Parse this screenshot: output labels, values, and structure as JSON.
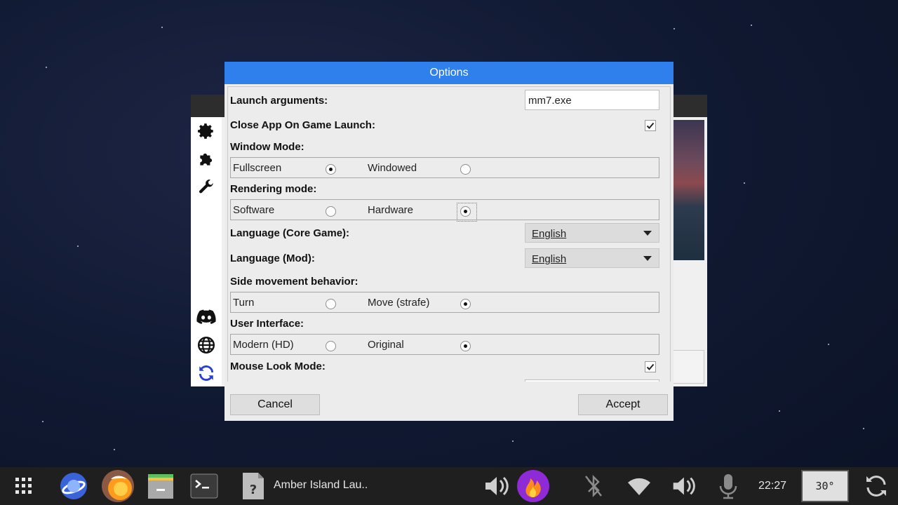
{
  "dialog": {
    "title": "Options",
    "launch_arguments": {
      "label": "Launch arguments:",
      "value": "mm7.exe"
    },
    "close_app": {
      "label": "Close App On Game Launch:",
      "checked": true
    },
    "window_mode": {
      "label": "Window Mode:",
      "options": [
        "Fullscreen",
        "Windowed"
      ],
      "selected": "Fullscreen"
    },
    "rendering_mode": {
      "label": "Rendering mode:",
      "options": [
        "Software",
        "Hardware"
      ],
      "selected": "Hardware"
    },
    "language_core": {
      "label": "Language (Core Game):",
      "value": "English"
    },
    "language_mod": {
      "label": "Language (Mod):",
      "value": "English"
    },
    "side_movement": {
      "label": "Side movement behavior:",
      "options": [
        "Turn",
        "Move (strafe)"
      ],
      "selected": "Move (strafe)"
    },
    "user_interface": {
      "label": "User Interface:",
      "options": [
        "Modern (HD)",
        "Original"
      ],
      "selected": "Original"
    },
    "mouse_look": {
      "label": "Mouse Look Mode:",
      "checked": true
    },
    "cancel_label": "Cancel",
    "accept_label": "Accept"
  },
  "sidebar_icons": [
    "gear-icon",
    "puzzle-icon",
    "wrench-icon",
    "discord-icon",
    "globe-icon",
    "refresh-icon"
  ],
  "taskbar": {
    "window_title": "Amber Island Lau..",
    "clock": "22:27",
    "temperature": "30°"
  },
  "colors": {
    "title_bar": "#2f80ed",
    "taskbar": "#1f1f1f",
    "refresh_icon": "#2a3fd6"
  }
}
